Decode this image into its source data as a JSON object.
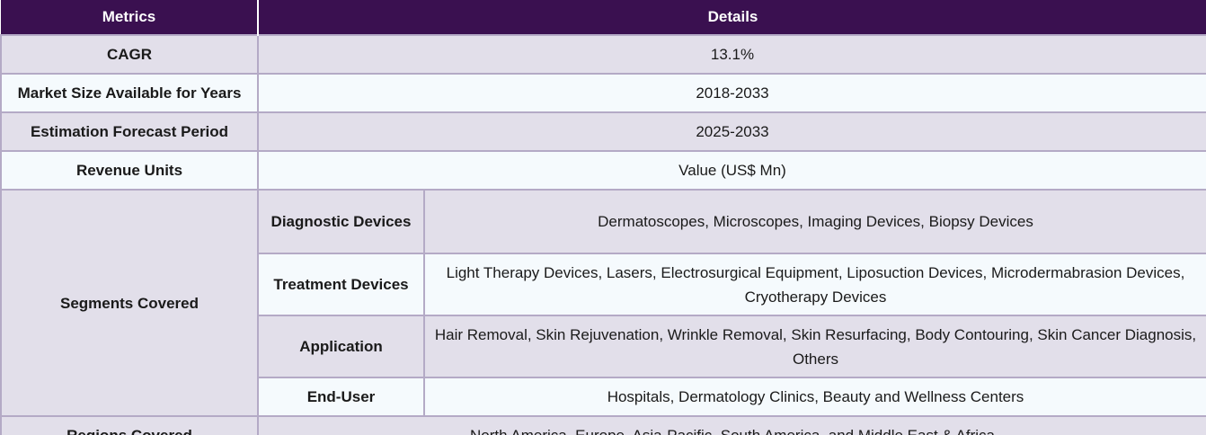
{
  "table": {
    "headers": [
      "Metrics",
      "Details"
    ],
    "rows": [
      {
        "metric": "CAGR",
        "detail": "13.1%"
      },
      {
        "metric": "Market Size Available for Years",
        "detail": "2018-2033"
      },
      {
        "metric": "Estimation Forecast Period",
        "detail": "2025-2033"
      },
      {
        "metric": "Revenue Units",
        "detail": "Value (US$ Mn)"
      }
    ],
    "segments": {
      "label": "Segments Covered",
      "items": [
        {
          "name": "Diagnostic Devices",
          "detail": "Dermatoscopes, Microscopes, Imaging Devices, Biopsy Devices"
        },
        {
          "name": "Treatment Devices",
          "detail": "Light Therapy Devices, Lasers, Electrosurgical Equipment, Liposuction Devices, Microdermabrasion Devices, Cryotherapy Devices"
        },
        {
          "name": "Application",
          "detail": "Hair Removal, Skin Rejuvenation, Wrinkle Removal, Skin Resurfacing, Body Contouring, Skin Cancer Diagnosis, Others"
        },
        {
          "name": "End-User",
          "detail": "Hospitals, Dermatology Clinics, Beauty and Wellness Centers"
        }
      ]
    },
    "regions": {
      "metric": "Regions Covered",
      "detail": "North America, Europe, Asia-Pacific, South America, and Middle East & Africa"
    }
  }
}
